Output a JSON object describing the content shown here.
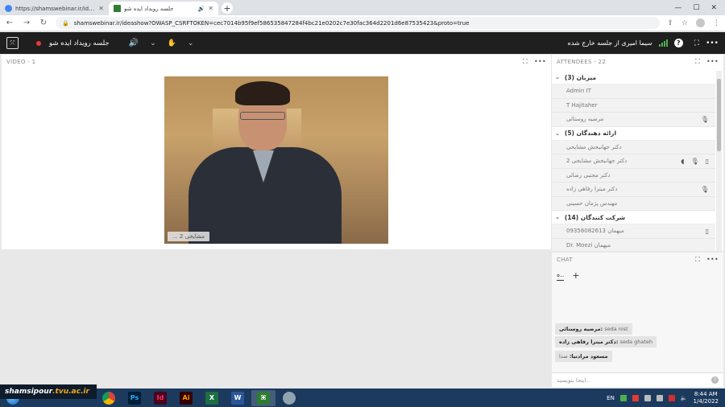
{
  "browser": {
    "tabs": [
      {
        "title": "https://shamswebinar.ir/ideashow",
        "active": false,
        "favicon_color": "#4285f4"
      },
      {
        "title": "جلسه رویداد ایده شو",
        "active": true,
        "favicon_color": "#2e7d32"
      }
    ],
    "url": "shamswebinar.ir/ideashow?OWASP_CSRFTOKEN=cec7014b95f9ef586535847284f4bc21e0202c7e30fac364d2201d6e87535423&proto=true"
  },
  "app": {
    "session_name": "جلسه رویداد ایده شو",
    "status_message": "سیما امیری از جلسه خارج شده"
  },
  "video_pod": {
    "header": "VIDEO",
    "count": "1",
    "participant_label": "... مشایخی 2"
  },
  "attendees_pod": {
    "header": "ATTENDEES",
    "count": "22",
    "groups": [
      {
        "title": "میزبان (3)",
        "members": [
          {
            "name": "Admin IT",
            "icon": ""
          },
          {
            "name": "T Hajitaher",
            "icon": ""
          },
          {
            "name": "مرضیه روستائی",
            "icon": "mic-icon"
          }
        ]
      },
      {
        "title": "ارائه دهندگان (5)",
        "members": [
          {
            "name": "دکتر جهانبخش مشایخی",
            "icon": ""
          },
          {
            "name": "دکتر جهانبخش مشایخی 2",
            "icon": "mobile-icon"
          },
          {
            "name": "دکتر مجتبی رضائی",
            "icon": ""
          },
          {
            "name": "دکتر میترا رفاهی زاده",
            "icon": "mic-icon"
          },
          {
            "name": "مهندس پژمان حسینی",
            "icon": ""
          }
        ]
      },
      {
        "title": "شرکت کنندگان (14)",
        "members": [
          {
            "name": "09356082613 میهمان",
            "icon": "mobile-icon"
          },
          {
            "name": "Dr. Moezi میهمان",
            "icon": ""
          }
        ]
      }
    ]
  },
  "chat_pod": {
    "header": "CHAT",
    "tab_label": "ه..",
    "messages": [
      {
        "sender": "مرضیه روستائی:",
        "text": "seda nist"
      },
      {
        "sender": "دکتر میترا رفاهی زاده:",
        "text": "seda ghateh"
      },
      {
        "sender": "مسعود مرادنیا:",
        "text": "صدا"
      }
    ],
    "input_placeholder": "اینجا بنویسید.."
  },
  "taskbar": {
    "language": "EN",
    "time": "8:44 AM",
    "date": "1/4/2022",
    "watermark_prefix": "shamsipour",
    "watermark_suffix": ".tvu.ac.ir",
    "apps": [
      {
        "label": "Ps",
        "bg": "#001e36",
        "fg": "#31a8ff"
      },
      {
        "label": "Id",
        "bg": "#49021f",
        "fg": "#ff3366"
      },
      {
        "label": "Ai",
        "bg": "#330000",
        "fg": "#ff9a00"
      },
      {
        "label": "X",
        "bg": "#1d6f42",
        "fg": "#ffffff"
      },
      {
        "label": "W",
        "bg": "#2b579a",
        "fg": "#ffffff"
      }
    ]
  },
  "colors": {
    "app_bar": "#1f1f1f",
    "accent_green": "#4caf50",
    "record_red": "#e53935"
  }
}
